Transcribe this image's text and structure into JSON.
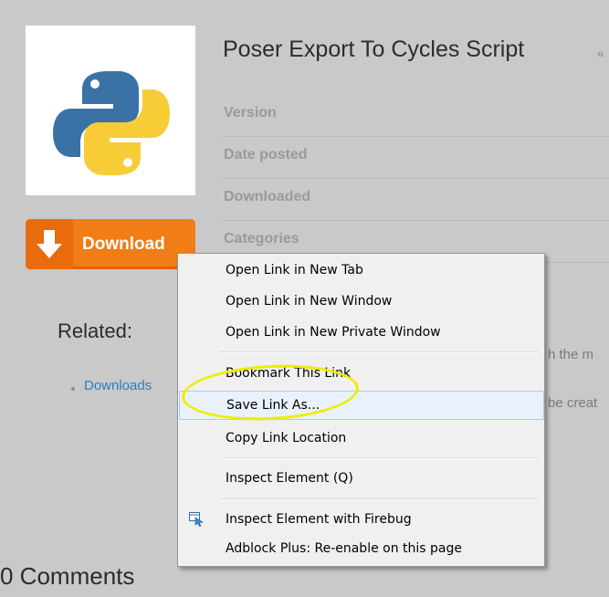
{
  "plugin": {
    "title": "Poser Export To Cycles Script",
    "title_extra": "«",
    "meta": [
      {
        "label": "Version"
      },
      {
        "label": "Date posted"
      },
      {
        "label": "Downloaded"
      },
      {
        "label": "Categories"
      }
    ],
    "download_label": "Download"
  },
  "related": {
    "heading": "Related:",
    "link": "Downloads",
    "partial_text_1": "h the m",
    "partial_text_2": "be creat"
  },
  "comments_heading": "0 Comments",
  "context_menu": {
    "items": [
      {
        "label": "Open Link in New Tab"
      },
      {
        "label": "Open Link in New Window"
      },
      {
        "label": "Open Link in New Private Window"
      },
      {
        "label": "Bookmark This Link"
      },
      {
        "label": "Save Link As..."
      },
      {
        "label": "Copy Link Location"
      },
      {
        "label": "Inspect Element (Q)"
      },
      {
        "label": "Inspect Element with Firebug"
      },
      {
        "label": "Adblock Plus: Re-enable on this page"
      }
    ]
  },
  "colors": {
    "download_orange": "#f07d15",
    "highlight_yellow": "#f0ec00",
    "link_blue": "#2b7ec1",
    "python_blue": "#3a72a6",
    "python_yellow": "#f7cc36"
  },
  "icons": [
    "python-logo-icon",
    "download-arrow-icon",
    "firebug-inspect-icon"
  ]
}
